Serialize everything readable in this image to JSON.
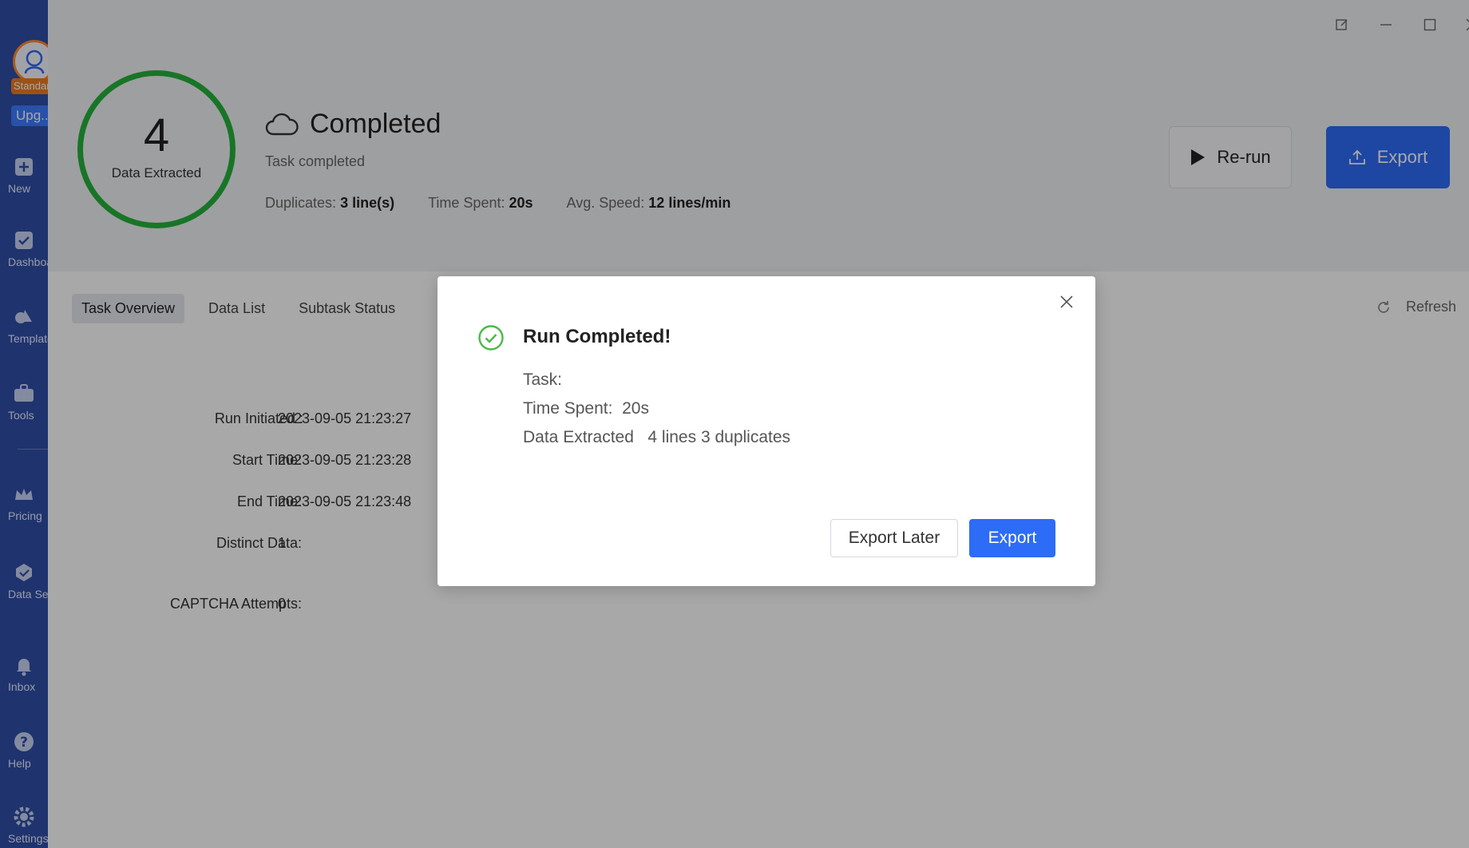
{
  "sidebar": {
    "plan_badge": "Standard",
    "upgrade_badge": "Upg...",
    "items": [
      {
        "label": "New",
        "icon": "plus-icon"
      },
      {
        "label": "Dashboard",
        "icon": "dashboard-check-icon"
      },
      {
        "label": "Templates",
        "icon": "templates-icon"
      },
      {
        "label": "Tools",
        "icon": "toolbox-icon"
      },
      {
        "label": "Pricing",
        "icon": "crown-icon"
      },
      {
        "label": "Data Service",
        "icon": "data-service-icon"
      },
      {
        "label": "Inbox",
        "icon": "bell-icon"
      },
      {
        "label": "Help",
        "icon": "help-icon"
      },
      {
        "label": "Settings",
        "icon": "gear-icon"
      }
    ]
  },
  "header": {
    "data_count": "4",
    "data_caption": "Data Extracted",
    "status_title": "Completed",
    "status_sub": "Task completed",
    "stats": {
      "duplicates_label": "Duplicates:",
      "duplicates_value": "3 line(s)",
      "time_label": "Time Spent:",
      "time_value": "20s",
      "speed_label": "Avg. Speed:",
      "speed_value": "12 lines/min"
    },
    "rerun_label": "Re-run",
    "export_label": "Export"
  },
  "tabs": [
    {
      "label": "Task Overview",
      "active": true
    },
    {
      "label": "Data List",
      "active": false
    },
    {
      "label": "Subtask Status",
      "active": false
    }
  ],
  "refresh_label": "Refresh",
  "overview": {
    "run_initiated_label": "Run Initiated :",
    "run_initiated_value": "2023-09-05 21:23:27",
    "start_time_label": "Start Time:",
    "start_time_value": "2023-09-05 21:23:28",
    "end_time_label": "End Time:",
    "end_time_value": "2023-09-05 21:23:48",
    "distinct_label": "Distinct Data:",
    "distinct_value": "1",
    "captcha_label": "CAPTCHA Attempts:",
    "captcha_value": "0"
  },
  "modal": {
    "title": "Run Completed!",
    "task_line": "Task:",
    "time_line": "Time Spent:  20s",
    "data_line": "Data Extracted   4 lines 3 duplicates",
    "later_label": "Export Later",
    "export_label": "Export"
  },
  "colors": {
    "sidebar": "#2f4ea7",
    "accent": "#2d6cf6",
    "success": "#25b23b",
    "plan_badge": "#f07b1f"
  }
}
